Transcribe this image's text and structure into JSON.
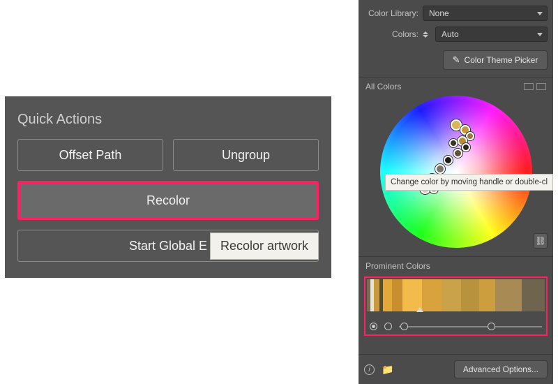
{
  "quick_actions": {
    "title": "Quick Actions",
    "offset_path": "Offset Path",
    "ungroup": "Ungroup",
    "recolor": "Recolor",
    "start_global": "Start Global E",
    "tooltip": "Recolor artwork"
  },
  "recolor_panel": {
    "color_library_label": "Color Library:",
    "color_library_value": "None",
    "colors_label": "Colors:",
    "colors_value": "Auto",
    "theme_picker": "Color Theme Picker",
    "all_colors": "All Colors",
    "wheel_tooltip": "Change color by moving handle or double-cl",
    "prominent_colors": "Prominent Colors",
    "advanced": "Advanced Options...",
    "prominent_strip": [
      {
        "color": "#7a6a52",
        "w": 2
      },
      {
        "color": "#e8e3d8",
        "w": 2
      },
      {
        "color": "#c79b3d",
        "w": 3
      },
      {
        "color": "#5d4b28",
        "w": 2
      },
      {
        "color": "#e2a83a",
        "w": 5
      },
      {
        "color": "#c98f2f",
        "w": 6
      },
      {
        "color": "#f2bb4a",
        "w": 11
      },
      {
        "color": "#d9a23c",
        "w": 11
      },
      {
        "color": "#caa24a",
        "w": 11
      },
      {
        "color": "#b8923d",
        "w": 10
      },
      {
        "color": "#cd9e3e",
        "w": 9
      },
      {
        "color": "#a88a55",
        "w": 15
      },
      {
        "color": "#6f654f",
        "w": 13
      }
    ]
  }
}
